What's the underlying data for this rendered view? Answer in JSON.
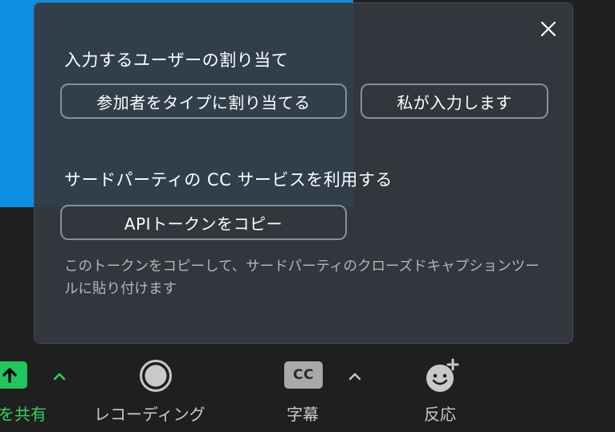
{
  "popup": {
    "close_icon": "close-icon",
    "assign_section": {
      "title": "入力するユーザーの割り当て",
      "assign_participant_label": "参加者をタイプに割り当てる",
      "i_will_type_label": "私が入力します"
    },
    "third_party_section": {
      "title": "サードパーティの CC サービスを利用する",
      "copy_api_token_label": "APIトークンをコピー",
      "helper_text": "このトークンをコピーして、サードパーティのクローズドキャプションツールに貼り付けます"
    }
  },
  "toolbar": {
    "share": {
      "label": "を共有",
      "icon": "share-screen-icon"
    },
    "record": {
      "label": "レコーディング",
      "icon": "record-icon"
    },
    "captions": {
      "label": "字幕",
      "icon_text": "CC"
    },
    "reactions": {
      "label": "反応",
      "icon": "emoji-reaction-icon"
    }
  },
  "colors": {
    "accent_green": "#22c55e",
    "popup_bg": "#343840",
    "video_blue": "#0e8ee0"
  }
}
